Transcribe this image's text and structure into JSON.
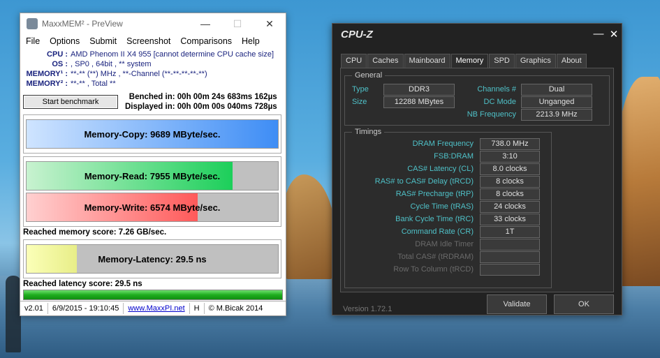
{
  "maxxmem": {
    "title": "MaxxMEM² - PreView",
    "window_controls": [
      "—",
      "☐",
      "✕"
    ],
    "menu": [
      "File",
      "Options",
      "Submit",
      "Screenshot",
      "Comparisons",
      "Help"
    ],
    "info": [
      {
        "label": "CPU :",
        "value": "AMD Phenom II X4 955  [cannot determine CPU cache size]"
      },
      {
        "label": "OS :",
        "value": ", SP0 , 64bit , ** system"
      },
      {
        "label": "MEMORY¹ :",
        "value": "**-** (**) MHz , **-Channel (**-**-**-**-**)"
      },
      {
        "label": "MEMORY² :",
        "value": "**-** , Total **"
      }
    ],
    "start_button": "Start benchmark",
    "benched": "Benched in: 00h 00m 24s 683ms 162µs",
    "displayed": "Displayed in: 00h 00m 00s 040ms 728µs",
    "copy_label": "Memory-Copy: 9689 MByte/sec.",
    "read_label": "Memory-Read: 7955 MByte/sec.",
    "write_label": "Memory-Write: 6574 MByte/sec.",
    "memory_score": "Reached memory score: 7.26 GB/sec.",
    "latency_label": "Memory-Latency: 29.5 ns",
    "latency_score": "Reached latency score: 29.5 ns",
    "bars": {
      "copy_fill": 1.0,
      "read_fill": 0.82,
      "write_fill": 0.68,
      "latency_fill": 0.2
    },
    "status": {
      "version": "v2.01",
      "date": "6/9/2015 - 19:10:45",
      "link": "www.MaxxPI.net",
      "h": "H",
      "copyright": "© M.Bicak 2014"
    }
  },
  "cpuz": {
    "title": "CPU-Z",
    "window_controls": [
      "—",
      "✕"
    ],
    "tabs": [
      "CPU",
      "Caches",
      "Mainboard",
      "Memory",
      "SPD",
      "Graphics",
      "About"
    ],
    "active_tab": "Memory",
    "general": {
      "title": "General",
      "type_label": "Type",
      "type": "DDR3",
      "size_label": "Size",
      "size": "12288 MBytes",
      "channels_label": "Channels #",
      "channels": "Dual",
      "dcmode_label": "DC Mode",
      "dcmode": "Unganged",
      "nbfreq_label": "NB Frequency",
      "nbfreq": "2213.9 MHz"
    },
    "timings": {
      "title": "Timings",
      "rows": [
        {
          "label": "DRAM Frequency",
          "value": "738.0 MHz"
        },
        {
          "label": "FSB:DRAM",
          "value": "3:10"
        },
        {
          "label": "CAS# Latency (CL)",
          "value": "8.0 clocks"
        },
        {
          "label": "RAS# to CAS# Delay (tRCD)",
          "value": "8 clocks"
        },
        {
          "label": "RAS# Precharge (tRP)",
          "value": "8 clocks"
        },
        {
          "label": "Cycle Time (tRAS)",
          "value": "24 clocks"
        },
        {
          "label": "Bank Cycle Time (tRC)",
          "value": "33 clocks"
        },
        {
          "label": "Command Rate (CR)",
          "value": "1T"
        },
        {
          "label": "DRAM Idle Timer",
          "value": ""
        },
        {
          "label": "Total CAS# (tRDRAM)",
          "value": ""
        },
        {
          "label": "Row To Column (tRCD)",
          "value": ""
        }
      ]
    },
    "version": "Version 1.72.1",
    "validate": "Validate",
    "ok": "OK"
  }
}
